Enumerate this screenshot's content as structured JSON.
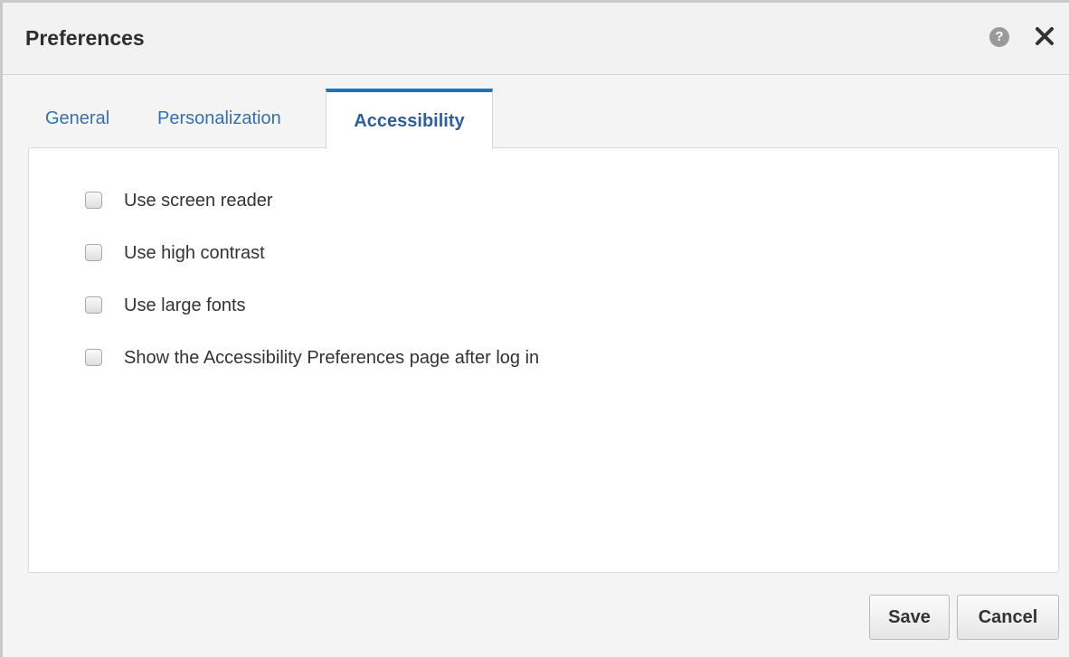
{
  "dialog": {
    "title": "Preferences",
    "help_icon": "question-circle-icon",
    "close_icon": "close-icon"
  },
  "tabs": [
    {
      "label": "General",
      "active": false
    },
    {
      "label": "Personalization",
      "active": false
    },
    {
      "label": "Accessibility",
      "active": true
    }
  ],
  "options": [
    {
      "label": "Use screen reader",
      "checked": false
    },
    {
      "label": "Use high contrast",
      "checked": false
    },
    {
      "label": "Use large fonts",
      "checked": false
    },
    {
      "label": "Show the Accessibility Preferences page after log in",
      "checked": false
    }
  ],
  "buttons": {
    "save_label": "Save",
    "cancel_label": "Cancel"
  },
  "colors": {
    "active_tab_accent": "#1c75bd",
    "tab_link": "#3a6fa8"
  }
}
